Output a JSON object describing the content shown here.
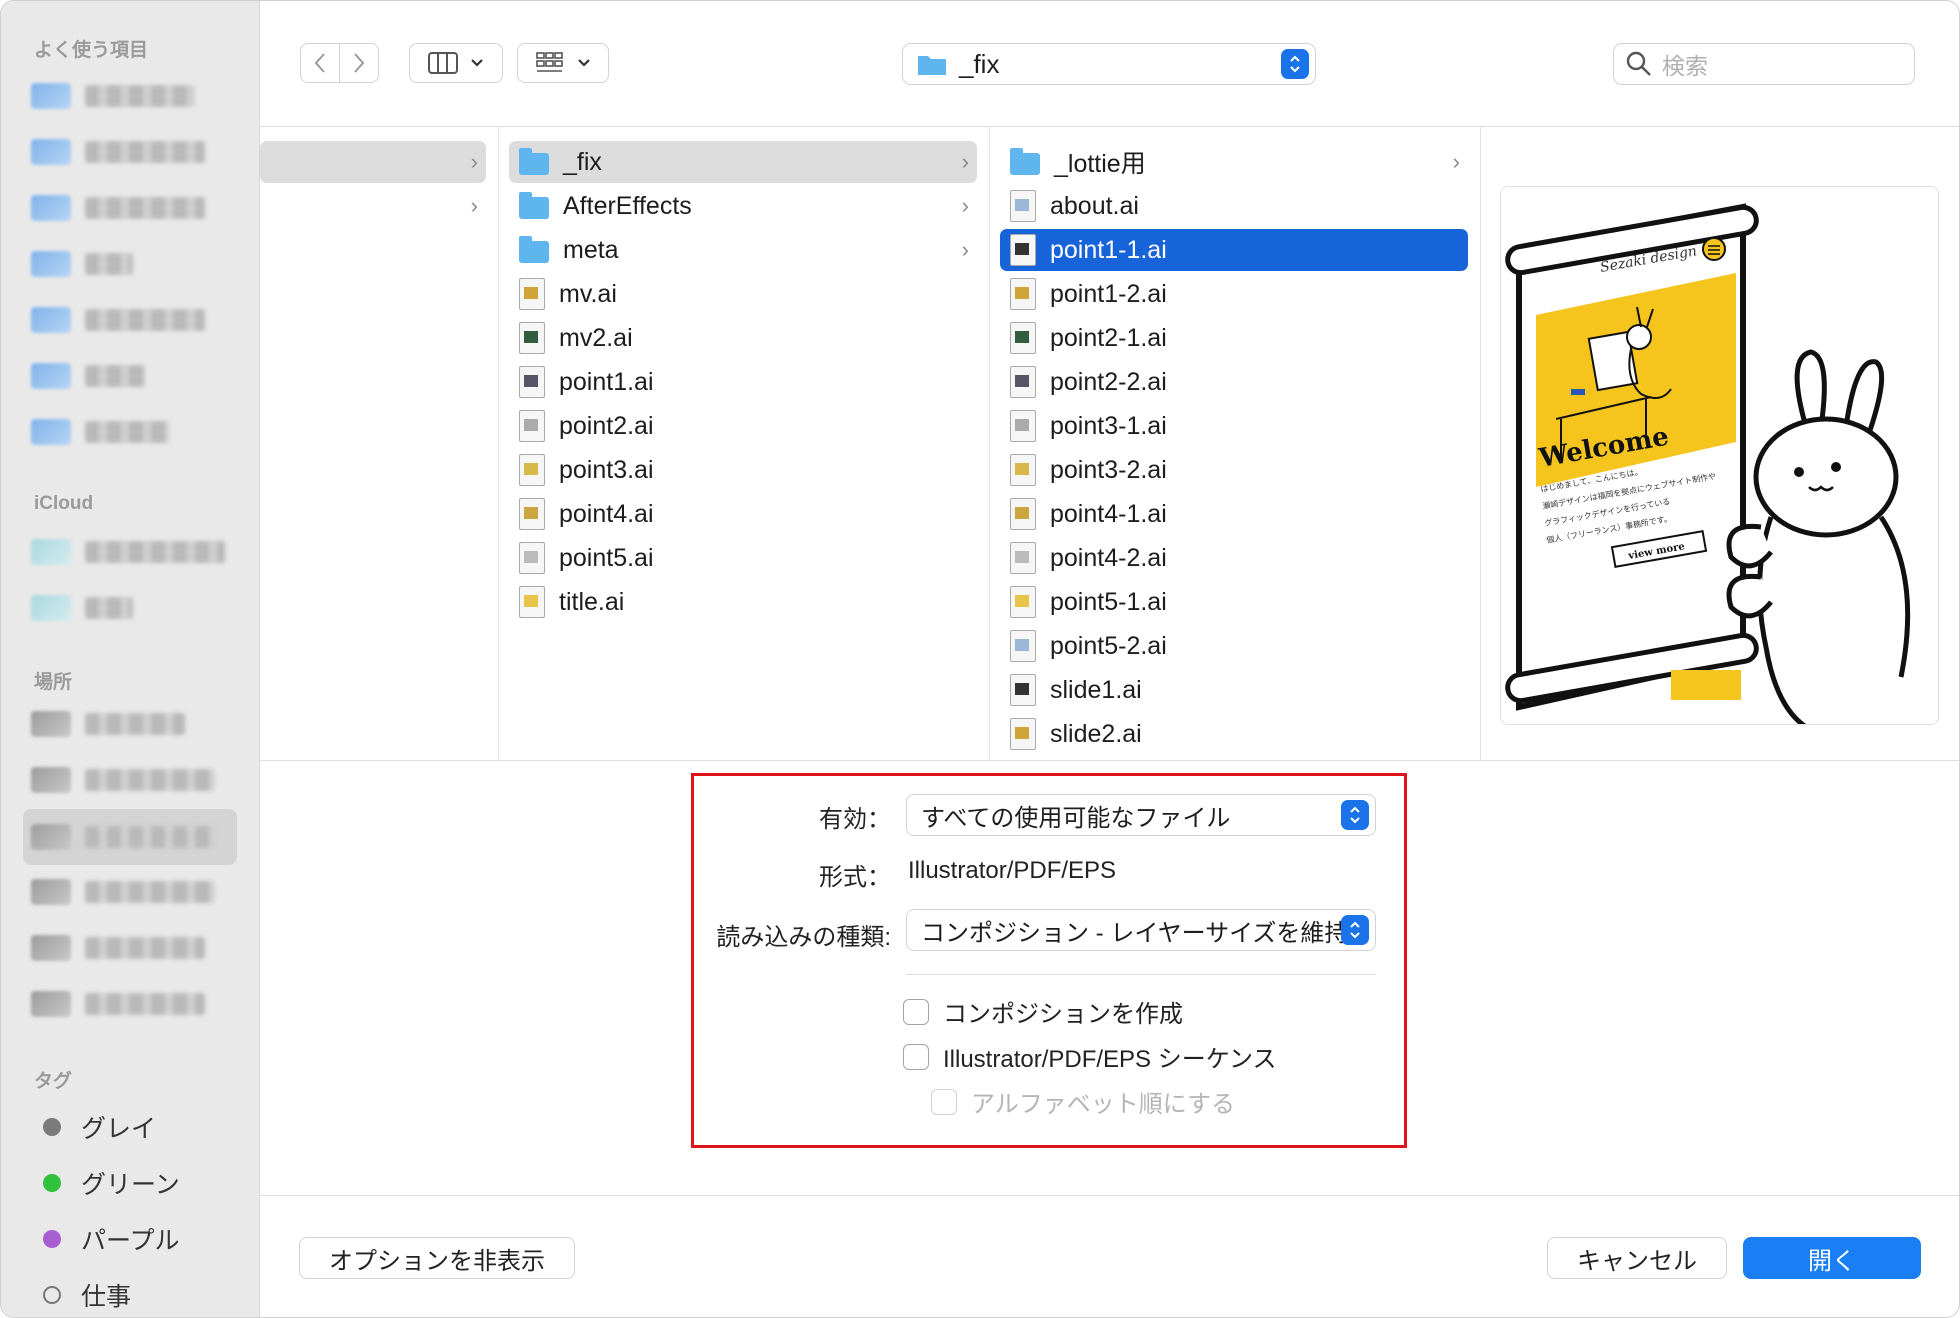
{
  "sidebar": {
    "favorites_header": "よく使う項目",
    "icloud_header": "iCloud",
    "locations_header": "場所",
    "tags_header": "タグ",
    "tags": [
      {
        "label": "グレイ",
        "color": "#7a7a7a"
      },
      {
        "label": "グリーン",
        "color": "#2fc23a"
      },
      {
        "label": "パープル",
        "color": "#a75ed1"
      },
      {
        "label": "仕事",
        "color": "none"
      }
    ]
  },
  "toolbar": {
    "back_icon": "chevron-left-icon",
    "forward_icon": "chevron-right-icon",
    "view_icon": "column-view-icon",
    "group_icon": "grid-icon",
    "path_label": "_fix",
    "search_placeholder": "検索"
  },
  "columns": {
    "col2": [
      {
        "name": "_fix",
        "type": "folder",
        "has_children": true,
        "selected": true
      },
      {
        "name": "AfterEffects",
        "type": "folder",
        "has_children": true
      },
      {
        "name": "meta",
        "type": "folder",
        "has_children": true
      },
      {
        "name": "mv.ai",
        "type": "file"
      },
      {
        "name": "mv2.ai",
        "type": "file"
      },
      {
        "name": "point1.ai",
        "type": "file"
      },
      {
        "name": "point2.ai",
        "type": "file"
      },
      {
        "name": "point3.ai",
        "type": "file"
      },
      {
        "name": "point4.ai",
        "type": "file"
      },
      {
        "name": "point5.ai",
        "type": "file"
      },
      {
        "name": "title.ai",
        "type": "file"
      }
    ],
    "col3": [
      {
        "name": "_lottie用",
        "type": "folder",
        "has_children": true
      },
      {
        "name": "about.ai",
        "type": "file"
      },
      {
        "name": "point1-1.ai",
        "type": "file",
        "selected": true
      },
      {
        "name": "point1-2.ai",
        "type": "file"
      },
      {
        "name": "point2-1.ai",
        "type": "file"
      },
      {
        "name": "point2-2.ai",
        "type": "file"
      },
      {
        "name": "point3-1.ai",
        "type": "file"
      },
      {
        "name": "point3-2.ai",
        "type": "file"
      },
      {
        "name": "point4-1.ai",
        "type": "file"
      },
      {
        "name": "point4-2.ai",
        "type": "file"
      },
      {
        "name": "point5-1.ai",
        "type": "file"
      },
      {
        "name": "point5-2.ai",
        "type": "file"
      },
      {
        "name": "slide1.ai",
        "type": "file"
      },
      {
        "name": "slide2.ai",
        "type": "file"
      }
    ]
  },
  "preview": {
    "brand": "Sezaki design",
    "heading": "Welcome",
    "body_lines": [
      "はじめまして、こんにちは。",
      "瀬崎デザインは福岡を拠点にウェブサイト制作や",
      "グラフィックデザインを行っている",
      "個人（フリーランス）事務所です。"
    ],
    "cta": "view more"
  },
  "options": {
    "enable_label": "有効：",
    "enable_value": "すべての使用可能なファイル",
    "format_label": "形式：",
    "format_value": "Illustrator/PDF/EPS",
    "import_label": "読み込みの種類:",
    "import_value": "コンポジション - レイヤーサイズを維持",
    "create_comp": "コンポジションを作成",
    "sequence": "Illustrator/PDF/EPS シーケンス",
    "alphabetical": "アルファベット順にする"
  },
  "footer": {
    "hide_options": "オプションを非表示",
    "cancel": "キャンセル",
    "open": "開く"
  }
}
